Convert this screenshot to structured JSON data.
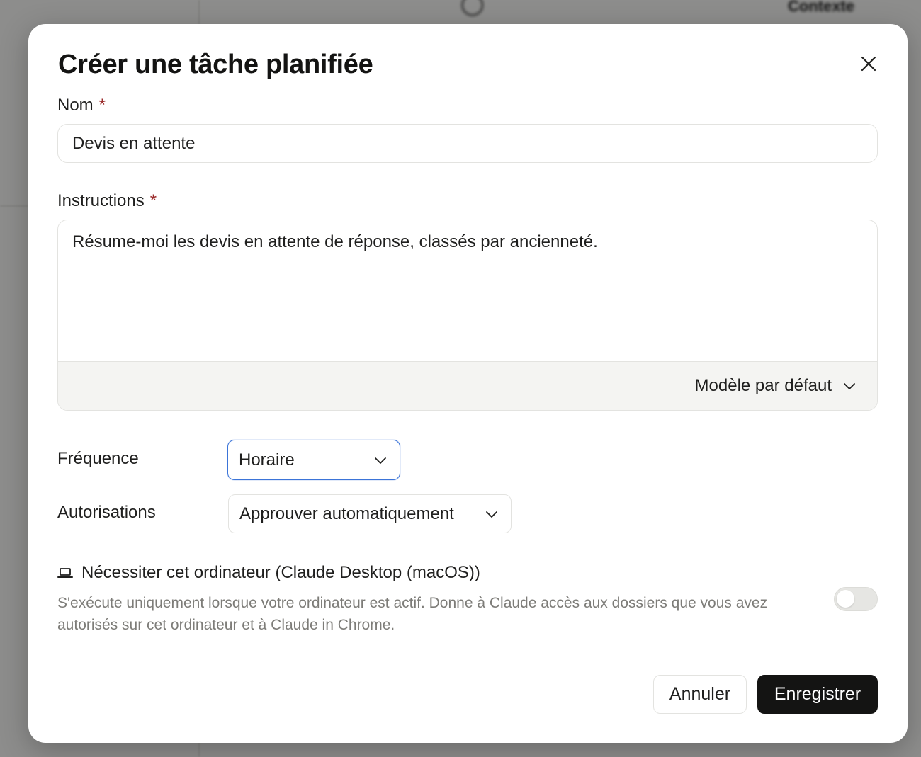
{
  "background": {
    "fragments": [
      "Contexte"
    ]
  },
  "dialog": {
    "title": "Créer une tâche planifiée",
    "close_icon": "close-icon"
  },
  "name_field": {
    "label": "Nom",
    "required_mark": "*",
    "value": "Devis en attente"
  },
  "instructions_field": {
    "label": "Instructions",
    "required_mark": "*",
    "value": "Résume-moi les devis en attente de réponse, classés par ancienneté.",
    "model_selector": "Modèle par défaut"
  },
  "frequency": {
    "label": "Fréquence",
    "selected": "Horaire"
  },
  "permissions": {
    "label": "Autorisations",
    "selected": "Approuver automatiquement"
  },
  "device_requirement": {
    "icon": "laptop-icon",
    "title": "Nécessiter cet ordinateur (Claude Desktop (macOS))",
    "description": "S'exécute uniquement lorsque votre ordinateur est actif. Donne à Claude accès aux dossiers que vous avez autorisés sur cet ordinateur et à Claude in Chrome.",
    "enabled": false
  },
  "actions": {
    "cancel_label": "Annuler",
    "save_label": "Enregistrer"
  },
  "colors": {
    "primary_button": "#141413",
    "focus_ring": "#3b74d8",
    "required": "#9b2c2c",
    "muted_text": "#7d7c78"
  }
}
